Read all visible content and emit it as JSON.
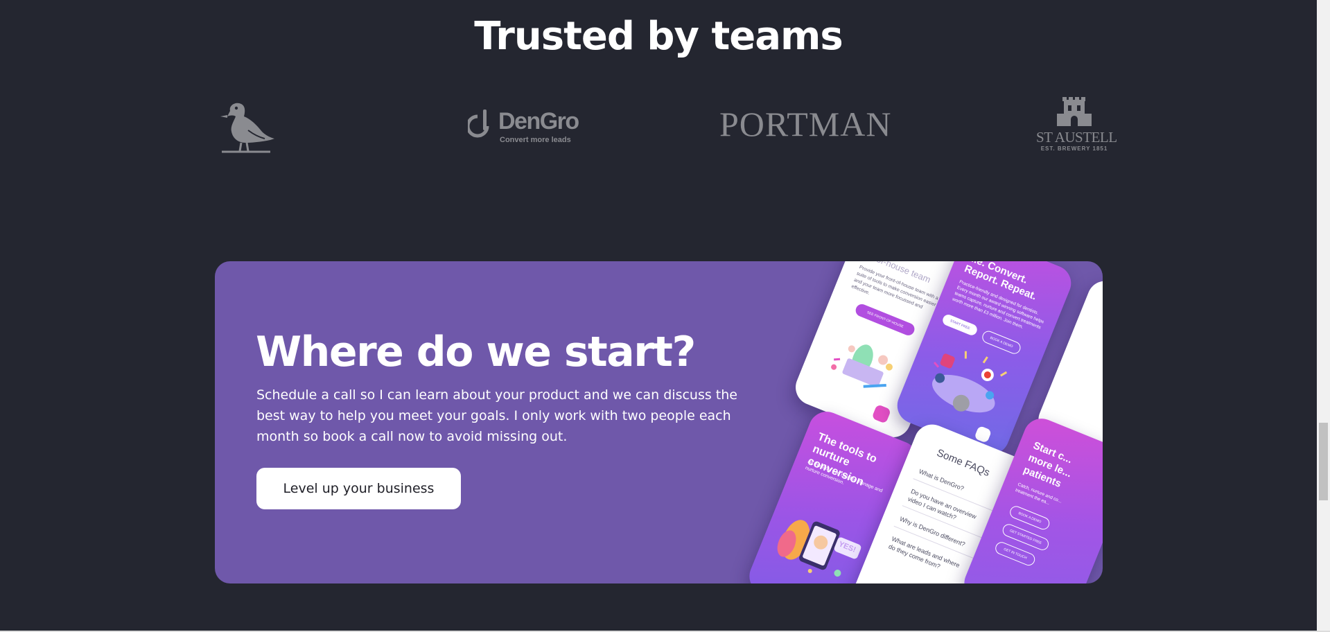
{
  "trusted": {
    "title": "Trusted by teams",
    "logos": {
      "bird": "bird-logo",
      "dengro": {
        "name": "DenGro",
        "trademark": "®",
        "tagline": "Convert more leads"
      },
      "portman": {
        "name": "PORTMAN"
      },
      "staustell": {
        "name": "ST AUSTELL",
        "sub": "EST. BREWERY 1851"
      }
    }
  },
  "cta": {
    "heading": "Where do we start?",
    "body": "Schedule a call so I can learn about your product and we can discuss the best way to help you meet your goals. I only work with two people each month so book a call now to avoid missing out.",
    "button_label": "Level up your business"
  },
  "mockups": {
    "phone1": {
      "title": "...of-house team",
      "body": "Provide your front-of-house team with a suite of tools to make conversion easier and your team more focussed and effective.",
      "button": "SEE FRONT-OF-HOUSE"
    },
    "phone2": {
      "title": "...e. Convert. Report. Repeat.",
      "body": "Practice-friendly and designed for dentists. Every month our award winning software helps teams capture, nurture and convert treatments worth more than £3 million. Join them.",
      "btn_start": "START FREE",
      "btn_demo": "BOOK A DEMO"
    },
    "phone4": {
      "title": "The tools to nurture conversion",
      "body": "All the tools you need to manage and nurture conversion.",
      "badge": "YES!"
    },
    "phone5": {
      "title": "Some FAQs",
      "q1": "What is DenGro?",
      "q2": "Do you have an overview video I can watch?",
      "q3": "Why is DenGro different?",
      "q4": "What are leads and where do they come from?"
    },
    "phone6": {
      "title": "Start c... more le... patients",
      "body": "Catch, nurture and co... treatment the ea...",
      "btn1": "BOOK A DEMO",
      "btn2": "GET STARTED FREE",
      "btn3": "GET IN TOUCH"
    }
  },
  "colors": {
    "background": "#242630",
    "card": "#6f58aa",
    "logo": "#8a8b90",
    "accent_purple": "#b14ee0",
    "accent_pink": "#e24fc4"
  }
}
